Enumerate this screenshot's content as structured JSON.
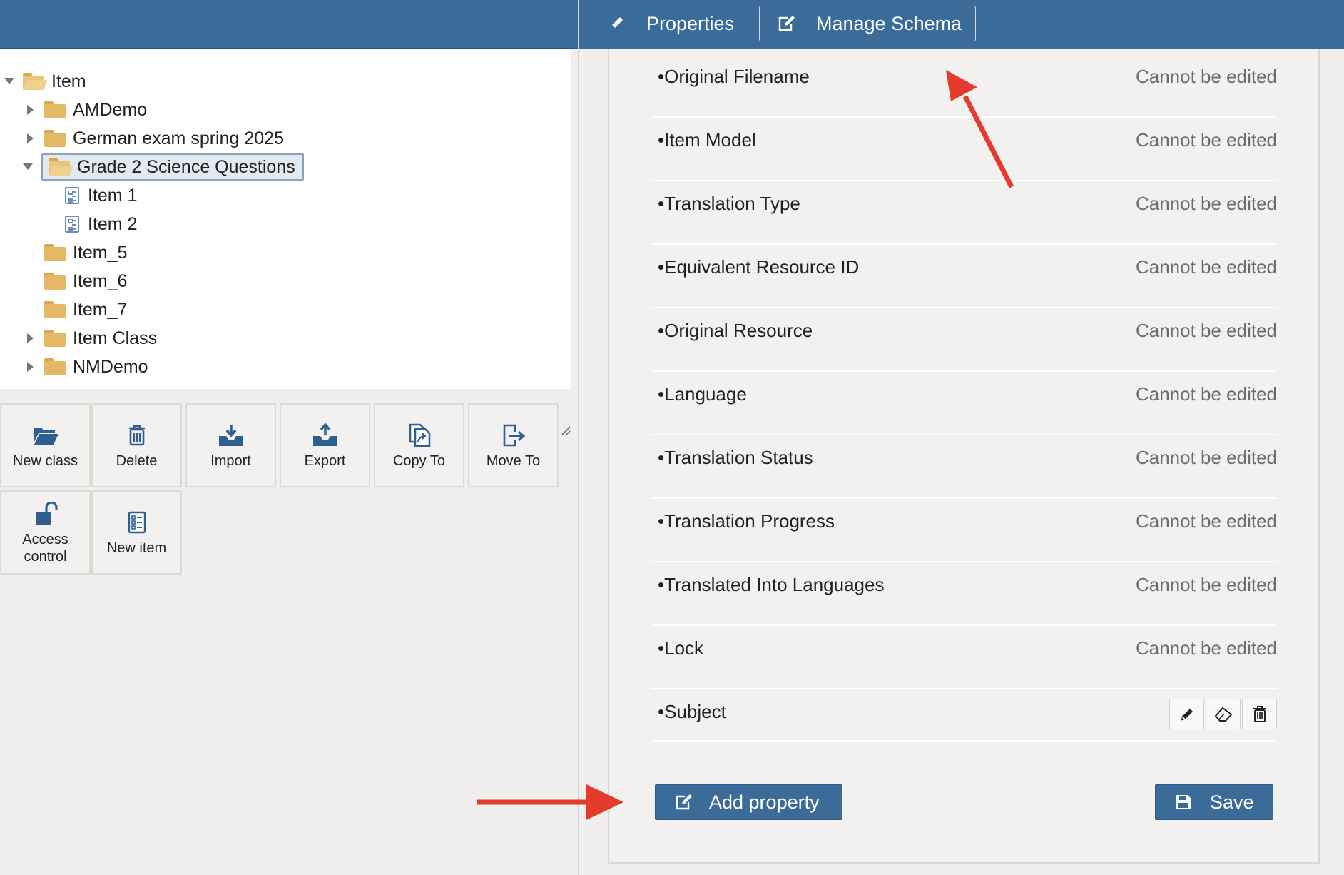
{
  "tree": {
    "root": "Item",
    "items": [
      {
        "label": "AMDemo"
      },
      {
        "label": "German exam spring 2025"
      },
      {
        "label": "Grade 2 Science Questions"
      },
      {
        "label": "Item 1"
      },
      {
        "label": "Item 2"
      },
      {
        "label": "Item_5"
      },
      {
        "label": "Item_6"
      },
      {
        "label": "Item_7"
      },
      {
        "label": "Item Class"
      },
      {
        "label": "NMDemo"
      }
    ]
  },
  "actions": [
    {
      "label": "New class",
      "icon": "folder-open-icon"
    },
    {
      "label": "Delete",
      "icon": "trash-icon"
    },
    {
      "label": "Import",
      "icon": "import-icon"
    },
    {
      "label": "Export",
      "icon": "export-icon"
    },
    {
      "label": "Copy To",
      "icon": "copy-icon"
    },
    {
      "label": "Move To",
      "icon": "move-icon"
    },
    {
      "label": "Access control",
      "icon": "unlock-icon"
    },
    {
      "label": "New item",
      "icon": "item-icon"
    }
  ],
  "header": {
    "properties_tab": "Properties",
    "schema_tab": "Manage Schema"
  },
  "properties": [
    {
      "name": "•Original Filename",
      "status": "Cannot be edited"
    },
    {
      "name": "•Item Model",
      "status": "Cannot be edited"
    },
    {
      "name": "•Translation Type",
      "status": "Cannot be edited"
    },
    {
      "name": "•Equivalent Resource ID",
      "status": "Cannot be edited"
    },
    {
      "name": "•Original Resource",
      "status": "Cannot be edited"
    },
    {
      "name": "•Language",
      "status": "Cannot be edited"
    },
    {
      "name": "•Translation Status",
      "status": "Cannot be edited"
    },
    {
      "name": "•Translation Progress",
      "status": "Cannot be edited"
    },
    {
      "name": "•Translated Into Languages",
      "status": "Cannot be edited"
    },
    {
      "name": "•Lock",
      "status": "Cannot be edited"
    },
    {
      "name": "•Subject",
      "status": ""
    }
  ],
  "buttons": {
    "add_property": "Add property",
    "save": "Save"
  },
  "colors": {
    "header": "#3a6b99",
    "annotation_arrow": "#e53b2c",
    "folder": "#e4b865"
  }
}
